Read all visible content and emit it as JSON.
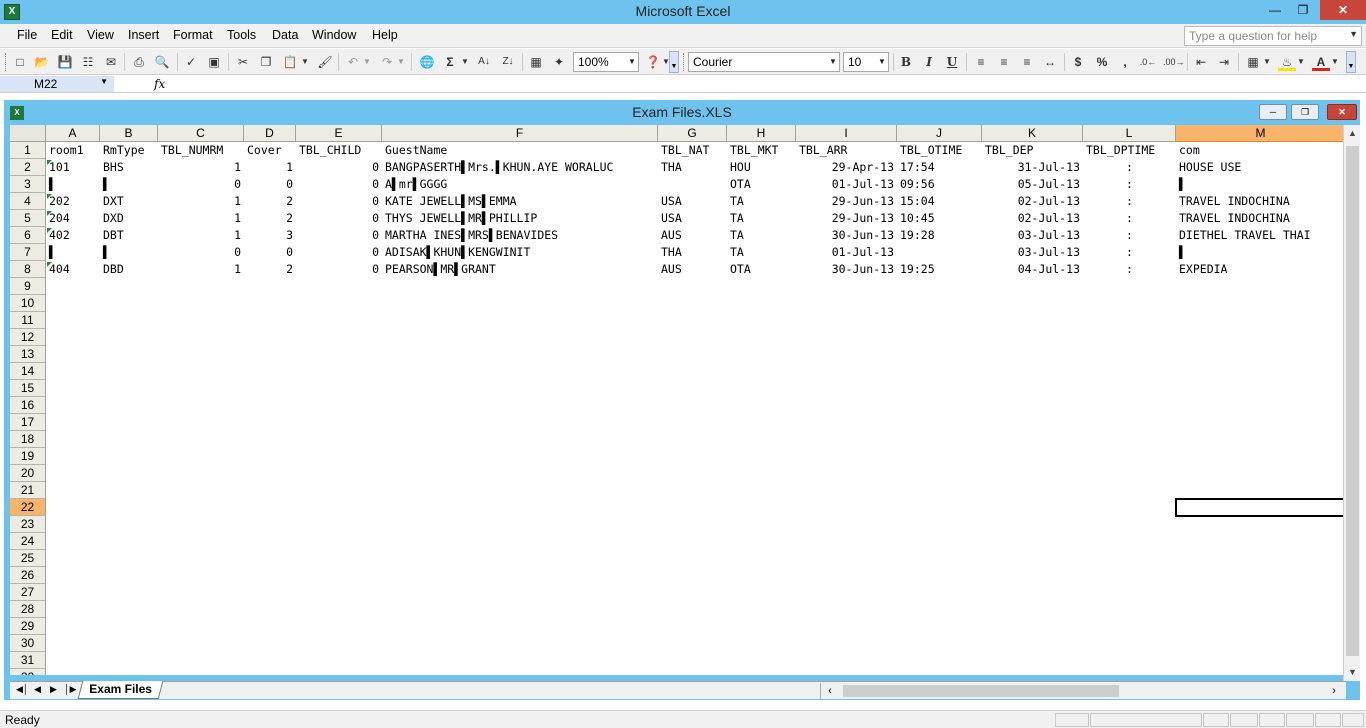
{
  "app": {
    "title": "Microsoft Excel"
  },
  "menu": [
    "File",
    "Edit",
    "View",
    "Insert",
    "Format",
    "Tools",
    "Data",
    "Window",
    "Help"
  ],
  "help_placeholder": "Type a question for help",
  "toolbar": {
    "zoom": "100%",
    "font": "Courier",
    "size": "10",
    "bold": "B",
    "italic": "I",
    "underline": "U",
    "currency": "$",
    "percent": "%",
    "comma": ","
  },
  "formula_bar": {
    "name_box": "M22",
    "fx": "fx",
    "value": ""
  },
  "workbook": {
    "title": "Exam Files.XLS",
    "sheet_tab": "Exam Files"
  },
  "grid": {
    "columns": [
      "A",
      "B",
      "C",
      "D",
      "E",
      "F",
      "G",
      "H",
      "I",
      "J",
      "K",
      "L",
      "M"
    ],
    "selected_column": "M",
    "selected_row": "22",
    "row_numbers": [
      "1",
      "2",
      "3",
      "4",
      "5",
      "6",
      "7",
      "8",
      "9",
      "10",
      "11",
      "12",
      "13",
      "14",
      "15",
      "16",
      "17",
      "18",
      "19",
      "20",
      "21",
      "22",
      "23",
      "24",
      "25",
      "26",
      "27",
      "28",
      "29",
      "30",
      "31",
      "32"
    ],
    "rows": [
      [
        "room1",
        "RmType",
        "TBL_NUMRM",
        "Cover",
        "TBL_CHILD",
        "GuestName",
        "TBL_NAT",
        "TBL_MKT",
        "TBL_ARR",
        "TBL_OTIME",
        "TBL_DEP",
        "TBL_DPTIME",
        "com"
      ],
      [
        "101",
        "BHS",
        "1",
        "1",
        "0",
        "BANGPASERTH▌Mrs.▌KHUN.AYE WORALUC",
        "THA",
        "HOU",
        "29-Apr-13",
        "17:54",
        "31-Jul-13",
        ":",
        "HOUSE USE"
      ],
      [
        "▌",
        "▌",
        "0",
        "0",
        "0",
        "A▌mr▌GGGG",
        "",
        "OTA",
        "01-Jul-13",
        "09:56",
        "05-Jul-13",
        ":",
        "▌"
      ],
      [
        "202",
        "DXT",
        "1",
        "2",
        "0",
        "KATE JEWELL▌MS▌EMMA",
        "USA",
        "TA",
        "29-Jun-13",
        "15:04",
        "02-Jul-13",
        ":",
        "TRAVEL INDOCHINA"
      ],
      [
        "204",
        "DXD",
        "1",
        "2",
        "0",
        "THYS JEWELL▌MR▌PHILLIP",
        "USA",
        "TA",
        "29-Jun-13",
        "10:45",
        "02-Jul-13",
        ":",
        "TRAVEL INDOCHINA"
      ],
      [
        "402",
        "DBT",
        "1",
        "3",
        "0",
        "MARTHA INES▌MRS▌BENAVIDES",
        "AUS",
        "TA",
        "30-Jun-13",
        "19:28",
        "03-Jul-13",
        ":",
        "DIETHEL TRAVEL THAI"
      ],
      [
        "▌",
        "▌",
        "0",
        "0",
        "0",
        "ADISAK▌KHUN▌KENGWINIT",
        "THA",
        "TA",
        "01-Jul-13",
        "",
        "03-Jul-13",
        ":",
        "▌"
      ],
      [
        "404",
        "DBD",
        "1",
        "2",
        "0",
        "PEARSON▌MR▌GRANT",
        "AUS",
        "OTA",
        "30-Jun-13",
        "19:25",
        "04-Jul-13",
        ":",
        "EXPEDIA"
      ]
    ]
  },
  "status": {
    "text": "Ready"
  }
}
